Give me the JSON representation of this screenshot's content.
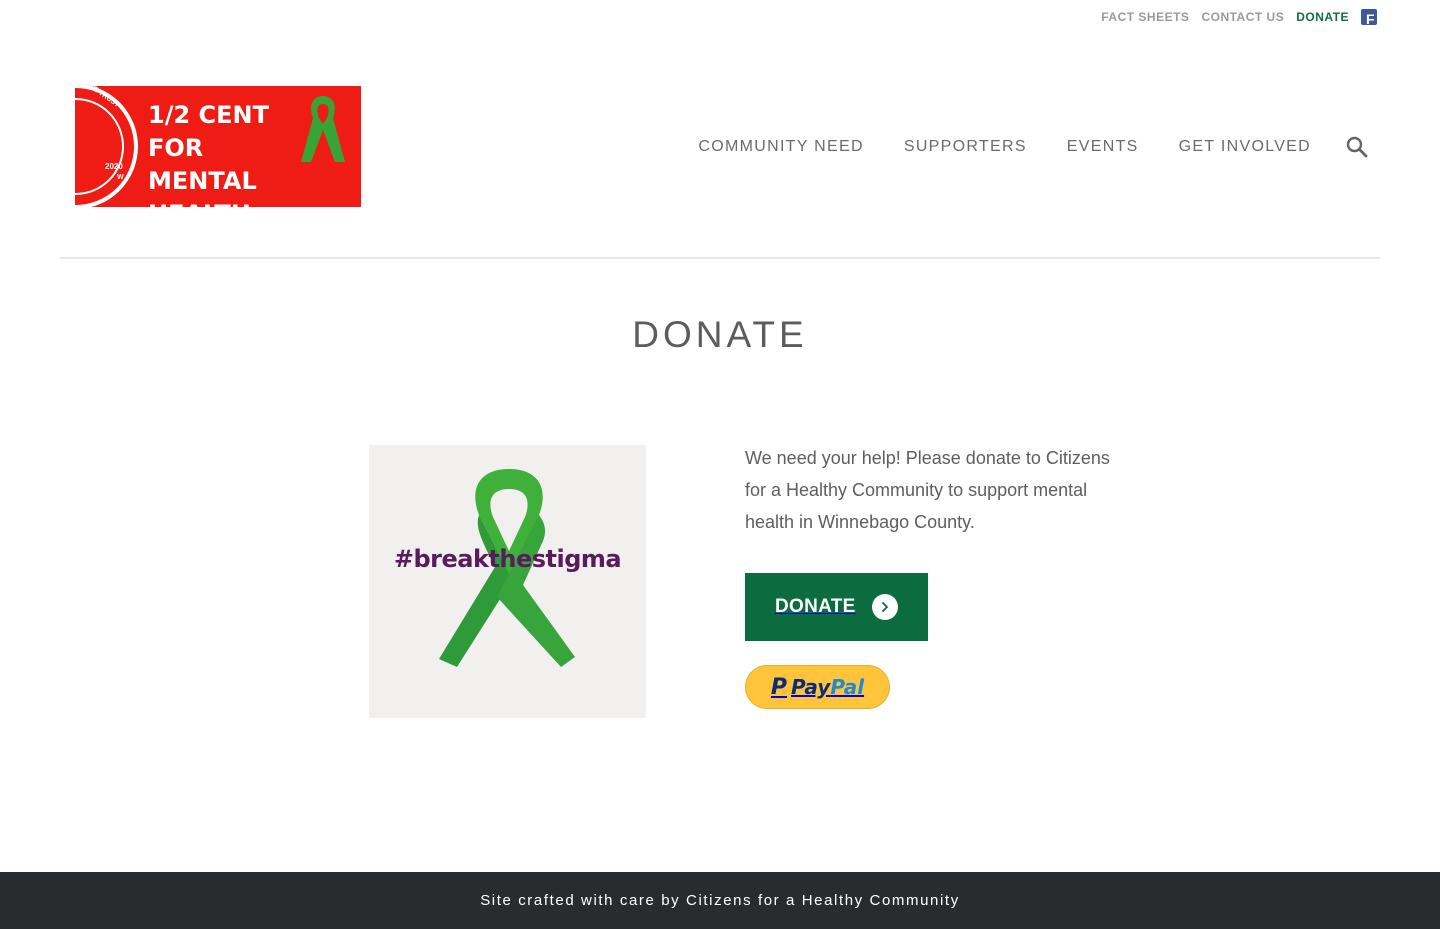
{
  "utility_nav": {
    "items": [
      {
        "label": "FACT SHEETS"
      },
      {
        "label": "CONTACT US"
      },
      {
        "label": "DONATE"
      }
    ],
    "social_icon": "facebook-icon"
  },
  "logo": {
    "lines": [
      "1/2 CENT",
      "FOR",
      "MENTAL HEALTH"
    ],
    "coin_year": "2020",
    "coin_mark": "W",
    "coin_motto": "WE TRUST",
    "brand_color": "#ee1c14"
  },
  "main_nav": {
    "items": [
      {
        "label": "COMMUNITY NEED"
      },
      {
        "label": "SUPPORTERS"
      },
      {
        "label": "EVENTS"
      },
      {
        "label": "GET INVOLVED"
      }
    ],
    "search_icon": "search-icon"
  },
  "page": {
    "title": "DONATE"
  },
  "hero_image": {
    "hashtag": "#breakthestigma",
    "ribbon_color": "#2e9a3a"
  },
  "content": {
    "body": "We need your help! Please donate to Citizens for a Healthy Community to support mental health in Winnebago County.",
    "donate_button": "DONATE",
    "paypal": {
      "pay": "Pay",
      "pal": "Pal"
    }
  },
  "footer": {
    "text": "Site crafted with care by Citizens for a Healthy Community"
  },
  "colors": {
    "accent": "#0c6b3f",
    "footer_bg": "#292c2f",
    "paypal_yellow": "#ffc439"
  }
}
